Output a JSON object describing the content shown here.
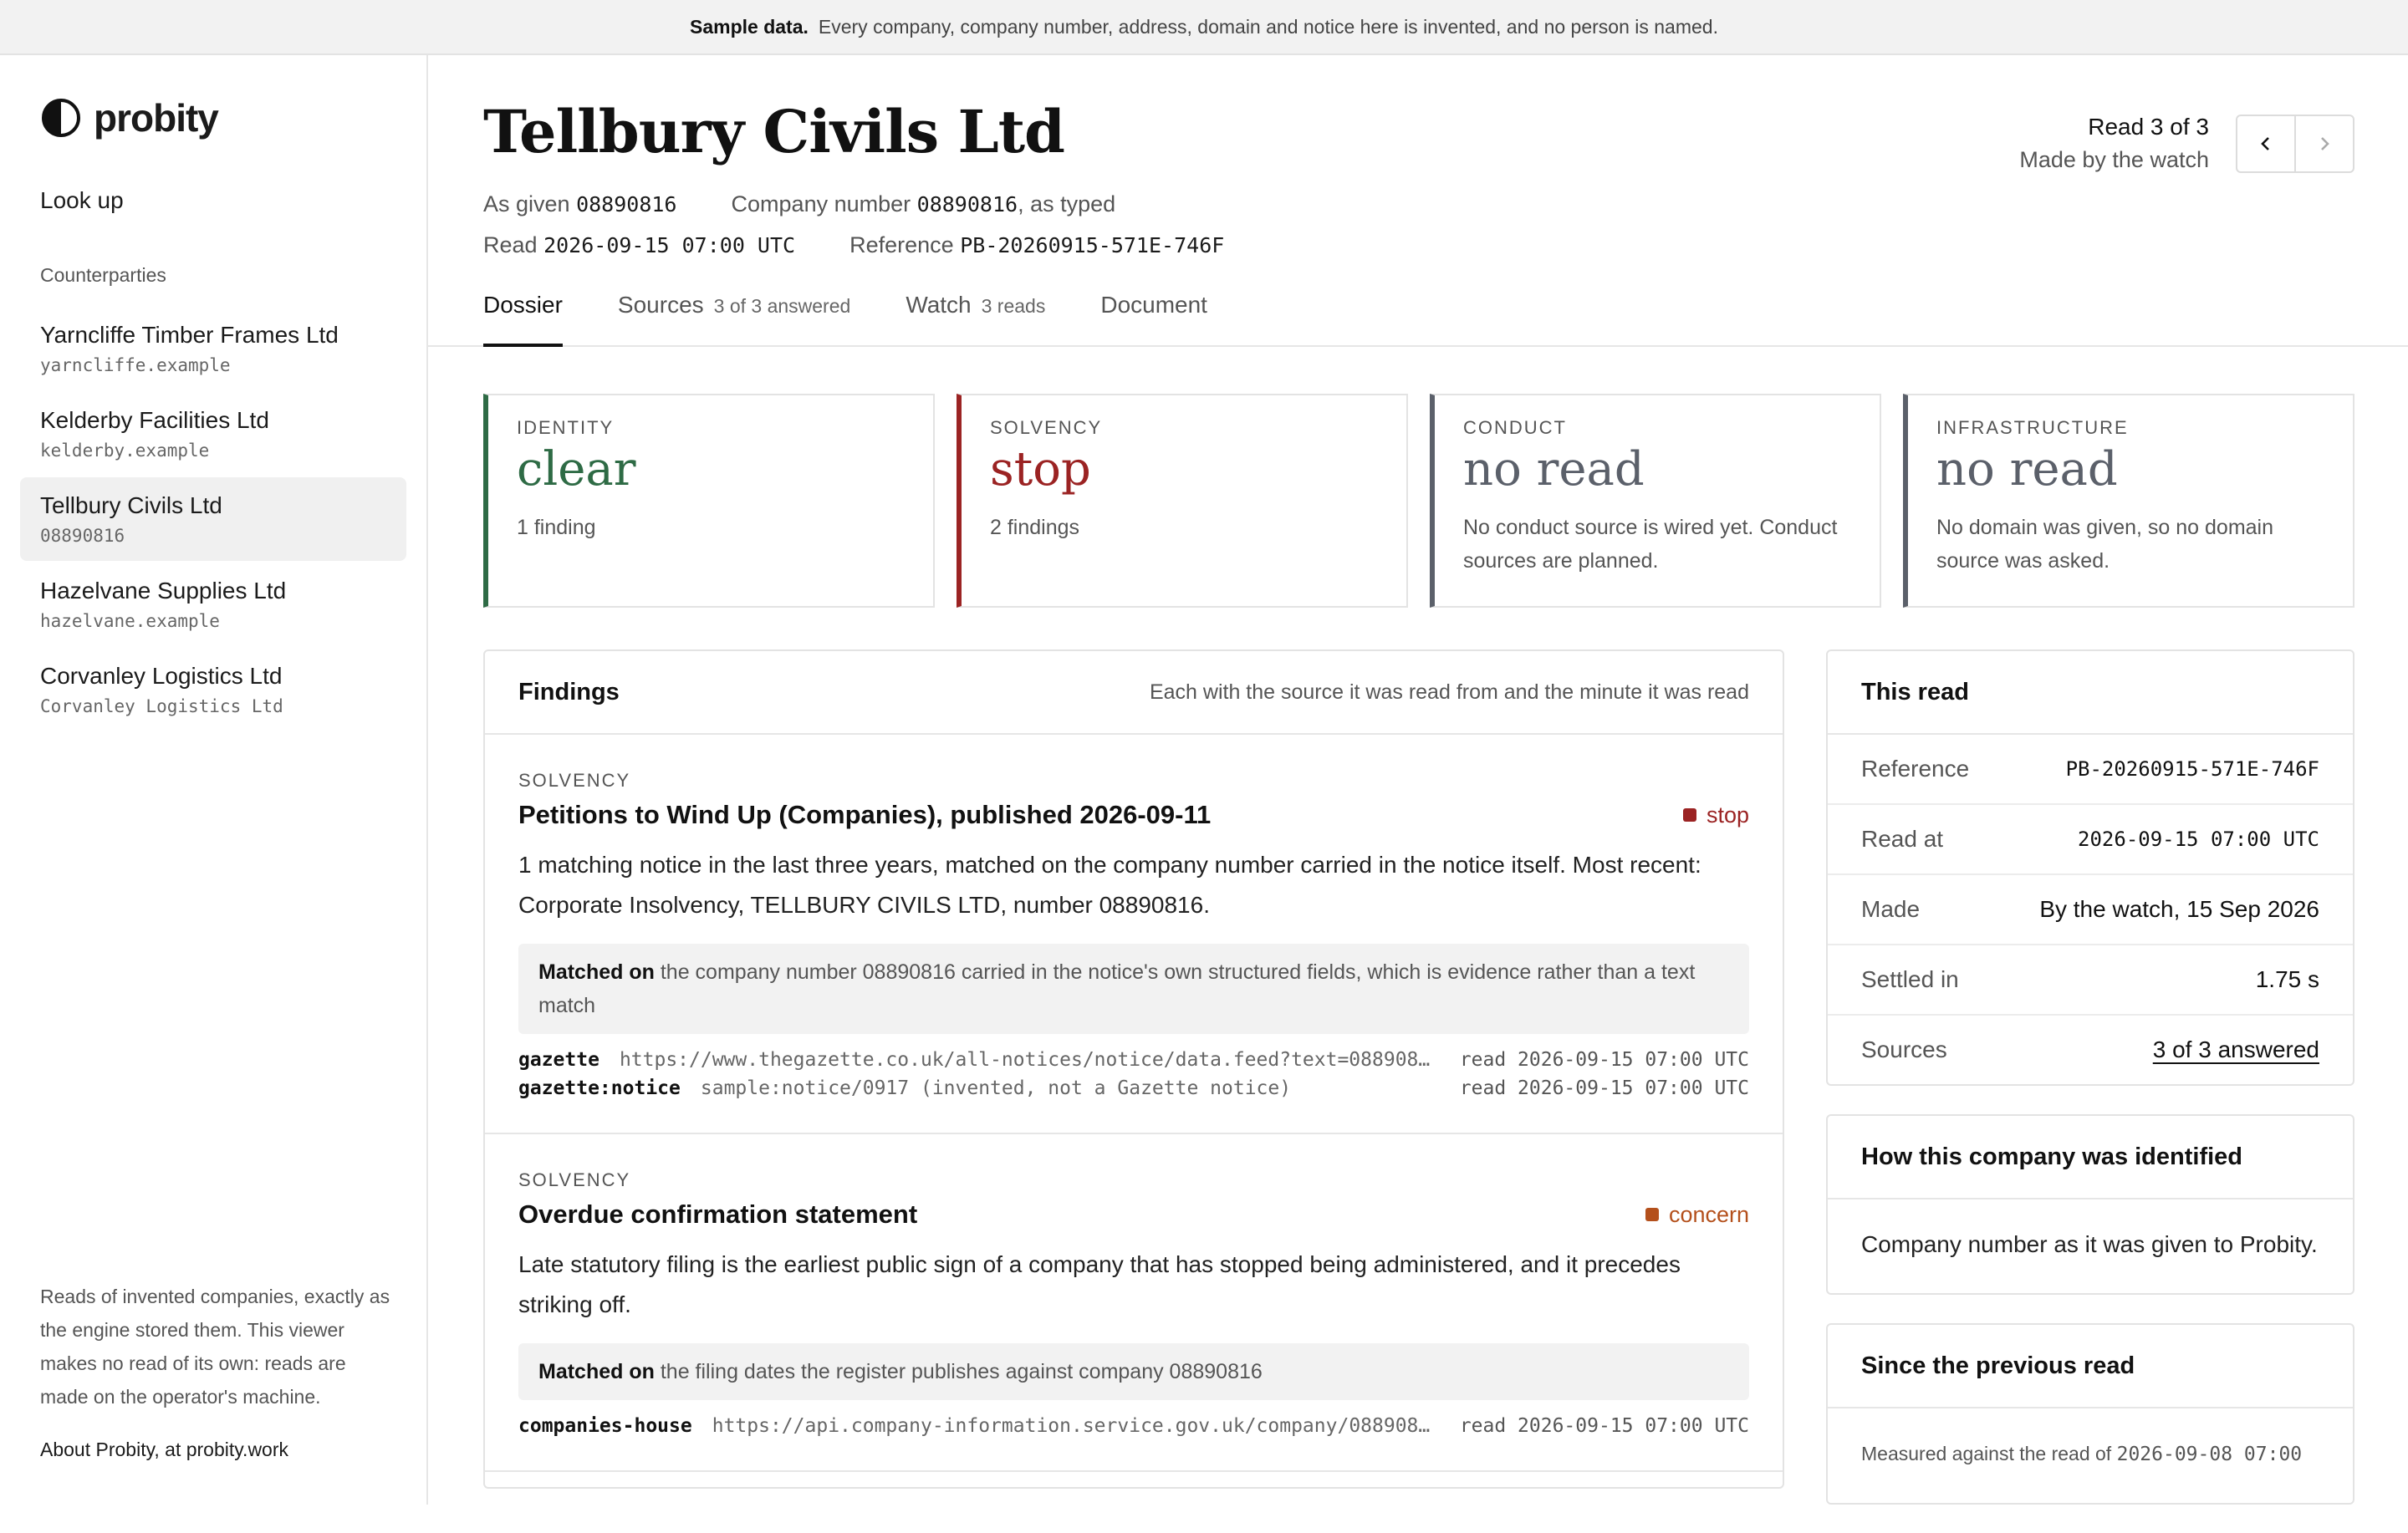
{
  "banner": {
    "label": "Sample data.",
    "text": "Every company, company number, address, domain and notice here is invented, and no person is named."
  },
  "sidebar": {
    "brand": "probity",
    "lookup": "Look up",
    "section_title": "Counterparties",
    "items": [
      {
        "name": "Yarncliffe Timber Frames Ltd",
        "sub": "yarncliffe.example"
      },
      {
        "name": "Kelderby Facilities Ltd",
        "sub": "kelderby.example"
      },
      {
        "name": "Tellbury Civils Ltd",
        "sub": "08890816"
      },
      {
        "name": "Hazelvane Supplies Ltd",
        "sub": "hazelvane.example"
      },
      {
        "name": "Corvanley Logistics Ltd",
        "sub": "Corvanley Logistics Ltd"
      }
    ],
    "note": "Reads of invented companies, exactly as the engine stored them. This viewer makes no read of its own: reads are made on the operator's machine.",
    "about": "About Probity, at probity.work"
  },
  "header": {
    "title": "Tellbury Civils Ltd",
    "as_given_label": "As given",
    "as_given_value": "08890816",
    "company_number_label": "Company number",
    "company_number_value": "08890816",
    "company_number_suffix": ", as typed",
    "read_label": "Read",
    "read_value": "2026-09-15 07:00 UTC",
    "reference_label": "Reference",
    "reference_value": "PB-20260915-571E-746F",
    "read_count": "Read 3 of 3",
    "read_made": "Made by the watch"
  },
  "tabs": [
    {
      "label": "Dossier",
      "count": ""
    },
    {
      "label": "Sources",
      "count": "3 of 3 answered"
    },
    {
      "label": "Watch",
      "count": "3 reads"
    },
    {
      "label": "Document",
      "count": ""
    }
  ],
  "cards": [
    {
      "label": "IDENTITY",
      "verdict": "clear",
      "note": "1 finding",
      "color": "#2e6b45"
    },
    {
      "label": "SOLVENCY",
      "verdict": "stop",
      "note": "2 findings",
      "color": "#9b2323"
    },
    {
      "label": "CONDUCT",
      "verdict": "no read",
      "note": "No conduct source is wired yet. Conduct sources are planned.",
      "color": "#5b606a"
    },
    {
      "label": "INFRASTRUCTURE",
      "verdict": "no read",
      "note": "No domain was given, so no domain source was asked.",
      "color": "#5b606a"
    }
  ],
  "findings": {
    "title": "Findings",
    "subtitle": "Each with the source it was read from and the minute it was read",
    "items": [
      {
        "category": "SOLVENCY",
        "title": "Petitions to Wind Up (Companies), published 2026-09-11",
        "badge": "stop",
        "badge_color": "#9b2323",
        "body": "1 matching notice in the last three years, matched on the company number carried in the notice itself. Most recent: Corporate Insolvency, TELLBURY CIVILS LTD, number 08890816.",
        "match_label": "Matched on",
        "match_text": "the company number 08890816 carried in the notice's own structured fields, which is evidence rather than a text match",
        "sources": [
          {
            "name": "gazette",
            "url": "https://www.thegazette.co.uk/all-notices/notice/data.feed?text=08890816",
            "when": "read 2026-09-15 07:00 UTC"
          },
          {
            "name": "gazette:notice",
            "url": "sample:notice/0917 (invented, not a Gazette notice)",
            "when": "read 2026-09-15 07:00 UTC"
          }
        ]
      },
      {
        "category": "SOLVENCY",
        "title": "Overdue confirmation statement",
        "badge": "concern",
        "badge_color": "#b4501c",
        "body": "Late statutory filing is the earliest public sign of a company that has stopped being administered, and it precedes striking off.",
        "match_label": "Matched on",
        "match_text": "the filing dates the register publishes against company 08890816",
        "sources": [
          {
            "name": "companies-house",
            "url": "https://api.company-information.service.gov.uk/company/08890816",
            "when": "read 2026-09-15 07:00 UTC"
          }
        ]
      }
    ]
  },
  "this_read": {
    "title": "This read",
    "rows": [
      {
        "k": "Reference",
        "v": "PB-20260915-571E-746F"
      },
      {
        "k": "Read at",
        "v": "2026-09-15 07:00 UTC"
      },
      {
        "k": "Made",
        "v": "By the watch, 15 Sep 2026"
      },
      {
        "k": "Settled in",
        "v": "1.75 s"
      },
      {
        "k": "Sources",
        "v": "3 of 3 answered"
      }
    ]
  },
  "identified": {
    "title": "How this company was identified",
    "body": "Company number as it was given to Probity."
  },
  "previous": {
    "title": "Since the previous read",
    "body_prefix": "Measured against the read of",
    "body_value": "2026-09-08 07:00"
  }
}
